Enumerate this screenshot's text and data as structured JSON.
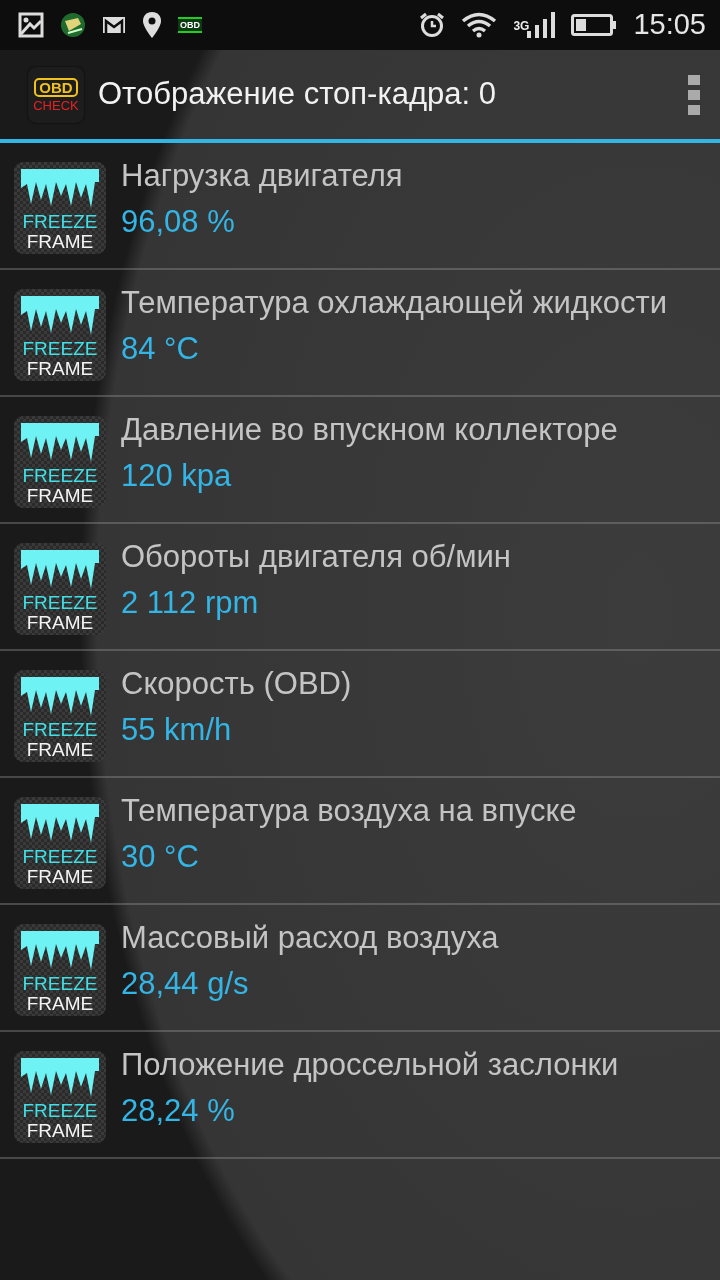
{
  "status_bar": {
    "network": "3G",
    "obd_label": "OBD",
    "time": "15:05"
  },
  "app_bar": {
    "logo_top": "OBD",
    "logo_bottom": "CHECK",
    "title": "Отображение стоп-кадра: 0"
  },
  "rows": [
    {
      "icon_top": "FREEZE",
      "icon_bottom": "FRAME",
      "title": "Нагрузка двигателя",
      "value": "96,08 %"
    },
    {
      "icon_top": "FREEZE",
      "icon_bottom": "FRAME",
      "title": "Температура охлаждающей жидкости",
      "value": "84 °C"
    },
    {
      "icon_top": "FREEZE",
      "icon_bottom": "FRAME",
      "title": "Давление во впускном коллекторе",
      "value": "120 kpa"
    },
    {
      "icon_top": "FREEZE",
      "icon_bottom": "FRAME",
      "title": "Обороты двигателя об/мин",
      "value": "2 112 rpm"
    },
    {
      "icon_top": "FREEZE",
      "icon_bottom": "FRAME",
      "title": "Скорость (OBD)",
      "value": "55 km/h"
    },
    {
      "icon_top": "FREEZE",
      "icon_bottom": "FRAME",
      "title": "Температура воздуха на впуске",
      "value": "30 °C"
    },
    {
      "icon_top": "FREEZE",
      "icon_bottom": "FRAME",
      "title": "Массовый расход воздуха",
      "value": "28,44 g/s"
    },
    {
      "icon_top": "FREEZE",
      "icon_bottom": "FRAME",
      "title": "Положение дроссельной заслонки",
      "value": "28,24 %"
    }
  ]
}
